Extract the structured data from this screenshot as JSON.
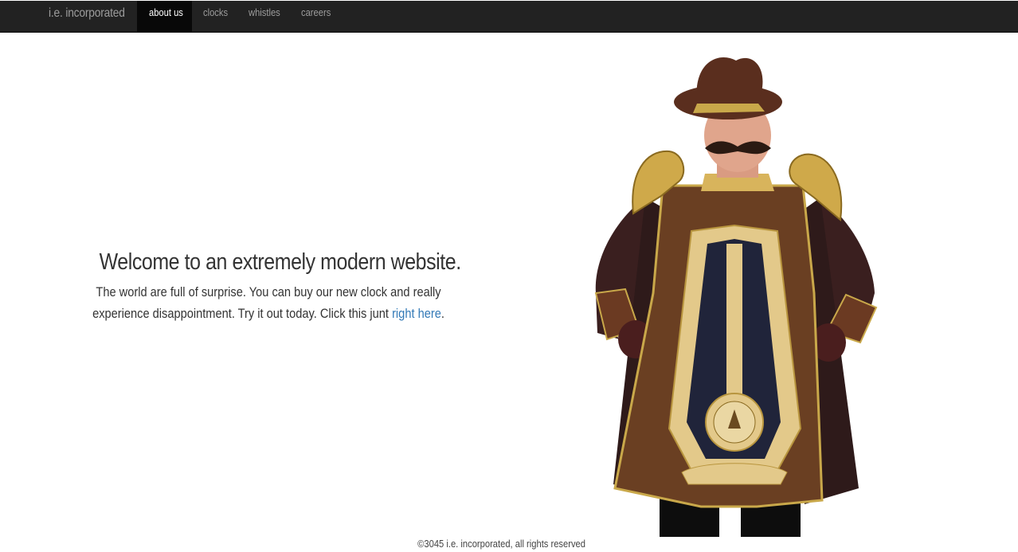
{
  "navbar": {
    "brand": "i.e. incorporated",
    "items": [
      {
        "label": "about us",
        "active": true
      },
      {
        "label": "clocks",
        "active": false
      },
      {
        "label": "whistles",
        "active": false
      },
      {
        "label": "careers",
        "active": false
      }
    ]
  },
  "hero": {
    "heading": "Welcome to an extremely modern website.",
    "body_text": "The world are full of surprise. You can buy our new clock and really experience disappointment. Try it out today. Click this junt",
    "link_text": "right here",
    "trailing": "."
  },
  "image": {
    "icon": "grandfather-clock-costume"
  },
  "footer": {
    "copyright": "©3045 i.e. incorporated, all rights reserved"
  },
  "colors": {
    "navbar_bg": "#222222",
    "nav_active_bg": "#080808",
    "nav_text": "#9d9d9d",
    "link": "#337ab7"
  }
}
